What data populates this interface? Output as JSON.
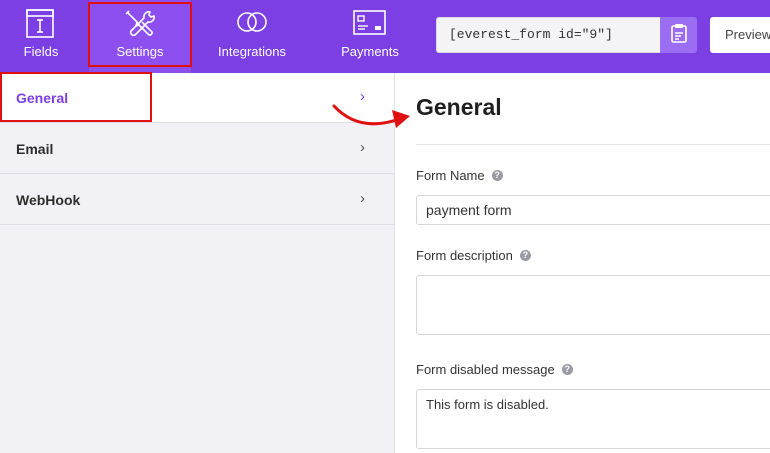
{
  "toolbar": {
    "tabs": [
      {
        "label": "Fields",
        "icon": "form-field-icon"
      },
      {
        "label": "Settings",
        "icon": "wrench-screwdriver-icon"
      },
      {
        "label": "Integrations",
        "icon": "linked-rings-icon"
      },
      {
        "label": "Payments",
        "icon": "credit-card-icon"
      }
    ],
    "shortcode": "[everest_form id=\"9\"]",
    "preview_label": "Preview"
  },
  "sidebar": {
    "items": [
      {
        "label": "General",
        "active": true
      },
      {
        "label": "Email",
        "active": false
      },
      {
        "label": "WebHook",
        "active": false
      }
    ]
  },
  "main": {
    "title": "General",
    "form_name": {
      "label": "Form Name",
      "value": "payment form"
    },
    "form_description": {
      "label": "Form description",
      "value": ""
    },
    "form_disabled_message": {
      "label": "Form disabled message",
      "value": "This form is disabled."
    }
  },
  "colors": {
    "brand": "#7b3fe4",
    "highlight": "#e01010"
  }
}
